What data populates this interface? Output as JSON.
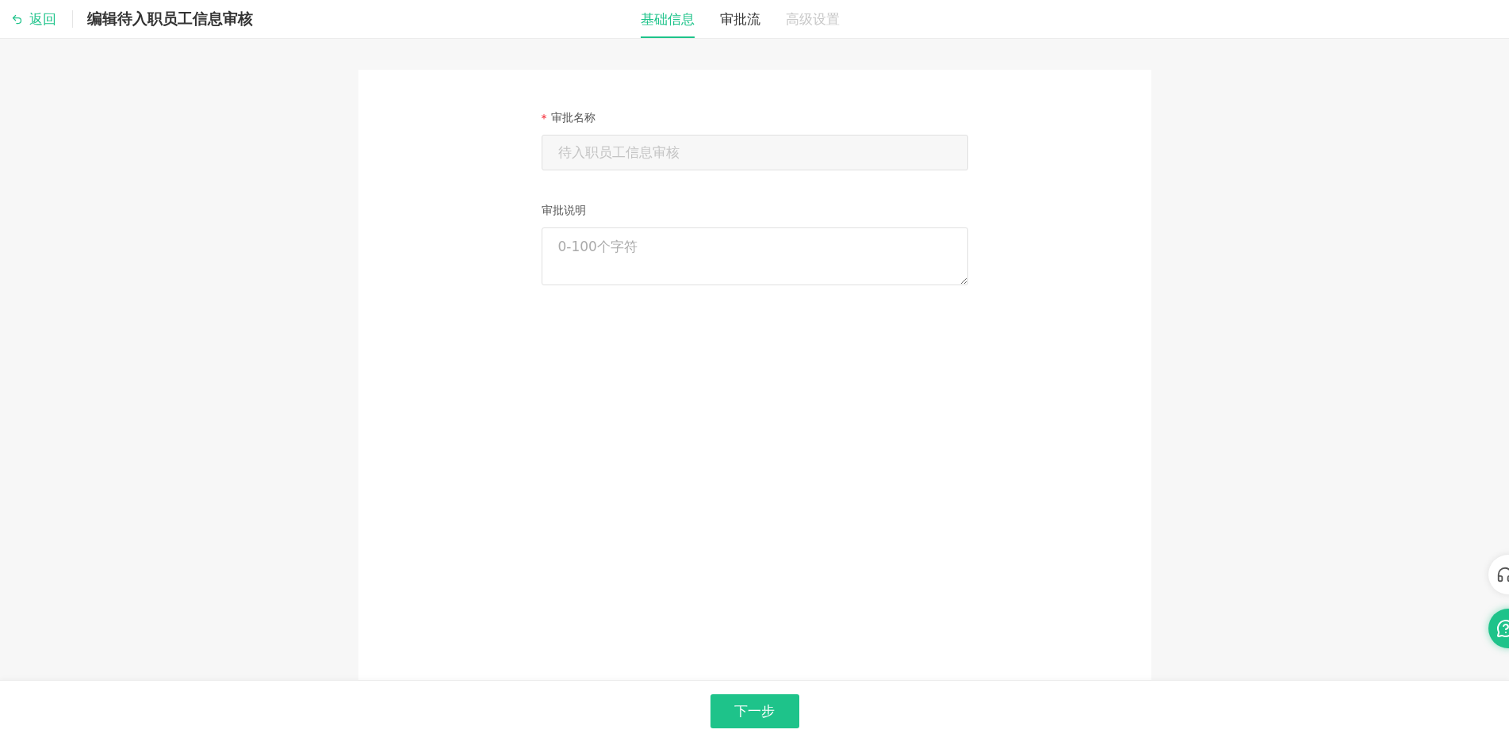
{
  "header": {
    "back": "返回",
    "title": "编辑待入职员工信息审核"
  },
  "tabs": [
    {
      "label": "基础信息",
      "selected": true,
      "disabled": false
    },
    {
      "label": "审批流",
      "selected": false,
      "disabled": false
    },
    {
      "label": "高级设置",
      "selected": false,
      "disabled": true
    }
  ],
  "form": [
    {
      "kind": "input",
      "label": "审批名称",
      "required_mark": "*",
      "disabled": true,
      "value": "待入职员工信息审核"
    },
    {
      "kind": "textarea",
      "label": "审批说明",
      "placeholder": "0-100个字符"
    }
  ],
  "footer": {
    "next": "下一步"
  }
}
